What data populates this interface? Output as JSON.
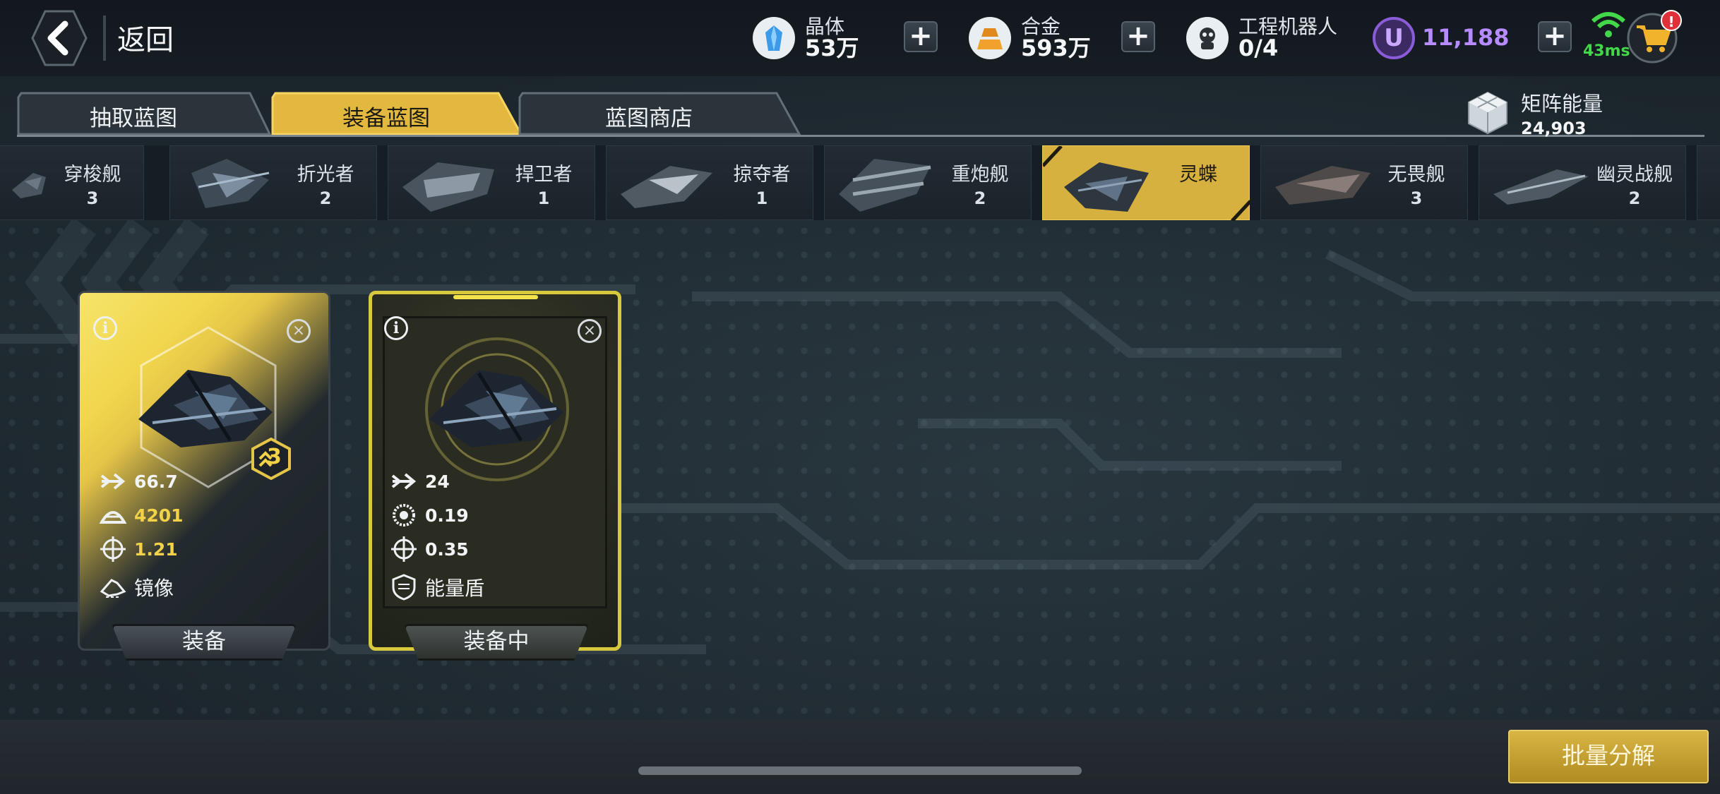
{
  "header": {
    "back_label": "返回",
    "resources": [
      {
        "name": "crystal",
        "label": "晶体",
        "value": "53万",
        "icon": "crystal-icon"
      },
      {
        "name": "alloy",
        "label": "合金",
        "value": "593万",
        "icon": "alloy-icon"
      },
      {
        "name": "robot",
        "label": "工程机器人",
        "value": "0/4",
        "icon": "robot-icon"
      }
    ],
    "currency_u": {
      "symbol": "U",
      "value": "11,188"
    },
    "ping": "43ms",
    "cart_badge": "!"
  },
  "tabs": [
    {
      "label": "抽取蓝图",
      "active": false
    },
    {
      "label": "装备蓝图",
      "active": true
    },
    {
      "label": "蓝图商店",
      "active": false
    }
  ],
  "matrix_energy": {
    "label": "矩阵能量",
    "value": "24,903"
  },
  "ships": [
    {
      "name": "穿梭舰",
      "count": "3",
      "active": false
    },
    {
      "name": "折光者",
      "count": "2",
      "active": false
    },
    {
      "name": "捍卫者",
      "count": "1",
      "active": false
    },
    {
      "name": "掠夺者",
      "count": "1",
      "active": false
    },
    {
      "name": "重炮舰",
      "count": "2",
      "active": false
    },
    {
      "name": "灵蝶",
      "count": "",
      "active": true
    },
    {
      "name": "无畏舰",
      "count": "3",
      "active": false
    },
    {
      "name": "幽灵战舰",
      "count": "2",
      "active": false
    }
  ],
  "cards": [
    {
      "level": "3",
      "stats": [
        {
          "icon": "speed-arrow-icon",
          "value": "66.7"
        },
        {
          "icon": "armor-dome-icon",
          "value": "4201"
        },
        {
          "icon": "crosshair-icon",
          "value": "1.21"
        },
        {
          "icon": "mirror-ship-icon",
          "value": "镜像"
        }
      ],
      "button": "装备"
    },
    {
      "stats": [
        {
          "icon": "speed-arrow-icon",
          "value": "24"
        },
        {
          "icon": "gear-ring-icon",
          "value": "0.19"
        },
        {
          "icon": "crosshair-icon",
          "value": "0.35"
        },
        {
          "icon": "shield-icon",
          "value": "能量盾"
        }
      ],
      "button": "装备中"
    }
  ],
  "bulk_button": "批量分解",
  "colors": {
    "accent_gold": "#d7b13f",
    "purple": "#b58bff",
    "ping_green": "#43d84a"
  }
}
